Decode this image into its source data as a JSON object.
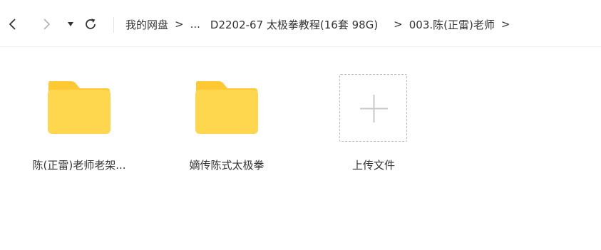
{
  "toolbar": {
    "breadcrumb": {
      "root": "我的网盘",
      "separator": ">",
      "ellipsis": "...",
      "parent": "D2202-67 太极拳教程(16套 98G)",
      "current": "003.陈(正雷)老师",
      "trailing_separator": ">"
    }
  },
  "folders": [
    {
      "name": "陈(正雷)老师老架..."
    },
    {
      "name": "嫡传陈式太极拳"
    }
  ],
  "upload": {
    "label": "上传文件"
  },
  "colors": {
    "folder_body": "#FFD74E",
    "folder_tab": "#FFC933",
    "upload_border": "#BDBDBD",
    "plus": "#C8C8C8"
  }
}
